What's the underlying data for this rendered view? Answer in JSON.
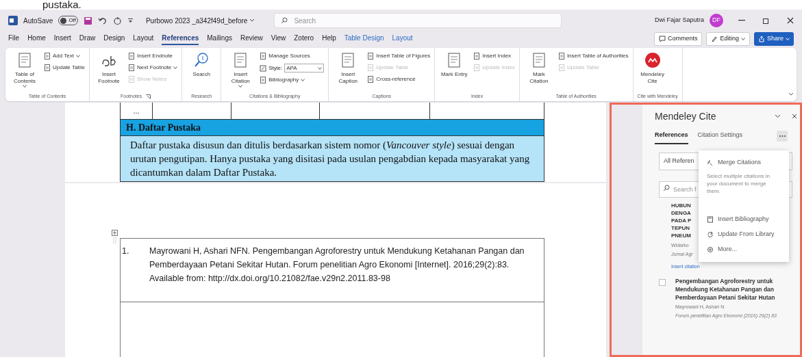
{
  "top_text": "pustaka.",
  "title_bar": {
    "autosave_label": "AutoSave",
    "autosave": {
      "on": false,
      "label": "Off"
    },
    "document_title": "Purbowo 2023 _a342f49d_before",
    "search": {
      "placeholder": "Search"
    },
    "user_name": "Dwi Fajar Saputra",
    "avatar_initials": "DF"
  },
  "tabs": [
    {
      "label": "File",
      "selected": false,
      "contextual": false
    },
    {
      "label": "Home",
      "selected": false,
      "contextual": false
    },
    {
      "label": "Insert",
      "selected": false,
      "contextual": false
    },
    {
      "label": "Draw",
      "selected": false,
      "contextual": false
    },
    {
      "label": "Design",
      "selected": false,
      "contextual": false
    },
    {
      "label": "Layout",
      "selected": false,
      "contextual": false
    },
    {
      "label": "References",
      "selected": true,
      "contextual": false
    },
    {
      "label": "Mailings",
      "selected": false,
      "contextual": false
    },
    {
      "label": "Review",
      "selected": false,
      "contextual": false
    },
    {
      "label": "View",
      "selected": false,
      "contextual": false
    },
    {
      "label": "Zotero",
      "selected": false,
      "contextual": false
    },
    {
      "label": "Help",
      "selected": false,
      "contextual": false
    },
    {
      "label": "Table Design",
      "selected": false,
      "contextual": true
    },
    {
      "label": "Layout",
      "selected": false,
      "contextual": true
    }
  ],
  "header_buttons": [
    {
      "label": "Comments",
      "kind": "comments",
      "menu": false
    },
    {
      "label": "Editing",
      "kind": "editing",
      "menu": true
    },
    {
      "label": "Share",
      "kind": "share",
      "menu": true
    }
  ],
  "ribbon_groups": [
    {
      "label": "Table of Contents",
      "launcher": false,
      "large": [
        {
          "label": "Table of Contents",
          "kind": "page",
          "menu": true
        }
      ],
      "small": [
        {
          "label": "Add Text",
          "kind": "button",
          "menu": true,
          "disabled": false
        },
        {
          "label": "Update Table",
          "kind": "button",
          "menu": false,
          "disabled": false
        }
      ]
    },
    {
      "label": "Footnotes",
      "launcher": true,
      "large": [
        {
          "label": "Insert Footnote",
          "kind": "footnote",
          "menu": false
        }
      ],
      "small": [
        {
          "label": "Insert Endnote",
          "kind": "button",
          "menu": false,
          "disabled": false
        },
        {
          "label": "Next Footnote",
          "kind": "button",
          "menu": true,
          "disabled": false
        },
        {
          "label": "Show Notes",
          "kind": "button",
          "menu": false,
          "disabled": true
        }
      ]
    },
    {
      "label": "Research",
      "launcher": false,
      "large": [
        {
          "label": "Search",
          "kind": "search",
          "menu": false
        }
      ]
    },
    {
      "label": "Citations & Bibliography",
      "launcher": false,
      "large": [
        {
          "label": "Insert Citation",
          "kind": "page",
          "menu": true
        }
      ],
      "small": [
        {
          "label": "Manage Sources",
          "kind": "button",
          "menu": false,
          "disabled": false
        },
        {
          "label": "Style:",
          "kind": "select",
          "value": "APA",
          "menu": true,
          "disabled": false
        },
        {
          "label": "Bibliography",
          "kind": "button",
          "menu": true,
          "disabled": false
        }
      ]
    },
    {
      "label": "Captions",
      "launcher": false,
      "large": [
        {
          "label": "Insert Caption",
          "kind": "page",
          "menu": false
        }
      ],
      "small": [
        {
          "label": "Insert Table of Figures",
          "kind": "button",
          "menu": false,
          "disabled": false
        },
        {
          "label": "Update Table",
          "kind": "button",
          "menu": false,
          "disabled": true
        },
        {
          "label": "Cross-reference",
          "kind": "button",
          "menu": false,
          "disabled": false
        }
      ]
    },
    {
      "label": "Index",
      "launcher": false,
      "large": [
        {
          "label": "Mark Entry",
          "kind": "page",
          "menu": false
        }
      ],
      "small": [
        {
          "label": "Insert Index",
          "kind": "button",
          "menu": false,
          "disabled": false
        },
        {
          "label": "Update Index",
          "kind": "button",
          "menu": false,
          "disabled": true
        }
      ]
    },
    {
      "label": "Table of Authorities",
      "launcher": false,
      "large": [
        {
          "label": "Mark Citation",
          "kind": "page",
          "menu": false
        }
      ],
      "small": [
        {
          "label": "Insert Table of Authorities",
          "kind": "button",
          "menu": false,
          "disabled": false
        },
        {
          "label": "Update Table",
          "kind": "button",
          "menu": false,
          "disabled": true
        }
      ]
    },
    {
      "label": "Cite with Mendeley",
      "launcher": false,
      "large": [
        {
          "label": "Mendeley Cite",
          "kind": "logo",
          "menu": false
        }
      ]
    }
  ],
  "document": {
    "page_1": {
      "table_row": [
        "..."
      ],
      "section_heading": "H. Daftar Pustaka",
      "section_text": "Daftar pustaka disusun dan ditulis berdasarkan sistem nomor (*Vancouver style*) sesuai dengan urutan pengutipan. Hanya pustaka yang disitasi pada usulan pengabdian kepada masyarakat yang dicantumkan dalam Daftar Pustaka."
    },
    "page_2": {
      "references": [
        {
          "number": "1.",
          "text": "Mayrowani H, Ashari NFN. Pengembangan Agroforestry untuk Mendukung Ketahanan Pangan dan Pemberdayaan Petani Sekitar Hutan. Forum penelitian Agro Ekonomi [Internet]. 2016;29(2):83. Available from: http://dx.doi.org/10.21082/fae.v29n2.2011.83-98"
        }
      ]
    }
  },
  "mendeley_panel": {
    "title": "Mendeley Cite",
    "tabs": [
      {
        "label": "References",
        "selected": true
      },
      {
        "label": "Citation Settings",
        "selected": false
      }
    ],
    "filter": {
      "value": "All Referen"
    },
    "search": {
      "placeholder": "Search f"
    },
    "references": [
      {
        "kind": "covered",
        "title_lines": [
          "HUBUN",
          "DENGA",
          "PADA P",
          "TEPUN",
          "PNEUM"
        ],
        "authors": "Widarko",
        "source": "Jurnal Agr",
        "action": "Insert citation"
      },
      {
        "kind": "full",
        "checked": false,
        "title": "Pengembangan Agroforestry untuk Mendukung Ketahanan Pangan dan Pemberdayaan Petani Sekitar Hutan",
        "authors": "Mayrowani H, Ashari N",
        "source": "Forum penelitian Agro Ekonomi (2016) 29(2) 83"
      }
    ],
    "menu": [
      {
        "kind": "action",
        "label": "Merge Citations"
      },
      {
        "kind": "note",
        "label": "Select multiple citations in your document to merge them."
      },
      {
        "kind": "action",
        "label": "Insert Bibliography"
      },
      {
        "kind": "action",
        "label": "Update From Library"
      },
      {
        "kind": "action",
        "label": "More..."
      }
    ]
  }
}
